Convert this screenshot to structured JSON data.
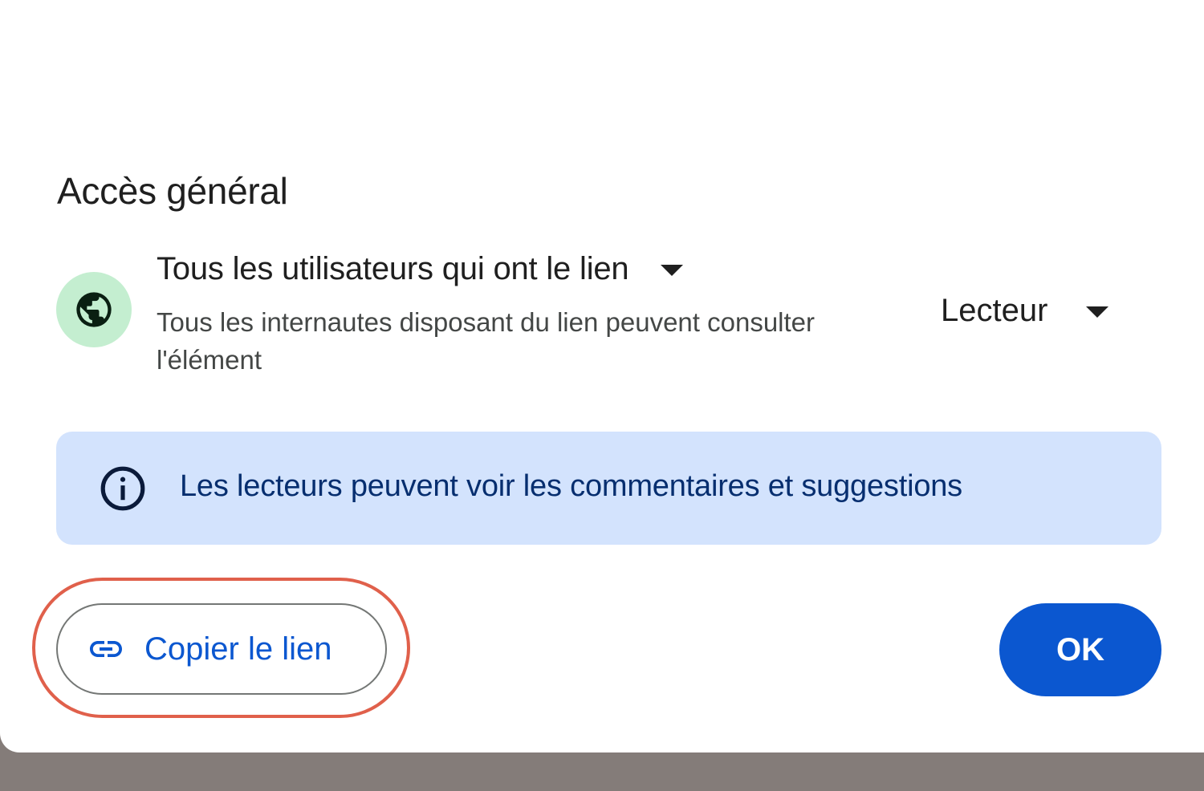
{
  "section": {
    "title": "Accès général"
  },
  "general_access": {
    "icon": "globe-icon",
    "label": "Tous les utilisateurs qui ont le lien",
    "description": "Tous les internautes disposant du lien peuvent consulter l'élément"
  },
  "role": {
    "label": "Lecteur"
  },
  "info_banner": {
    "icon": "info-icon",
    "text": "Les lecteurs peuvent voir les commentaires et suggestions"
  },
  "actions": {
    "copy_link_label": "Copier le lien",
    "copy_link_icon": "link-icon",
    "ok_label": "OK"
  },
  "colors": {
    "primary": "#0b57d0",
    "banner_bg": "#d3e3fd",
    "globe_bg": "#c4eed0",
    "highlight": "#e0604b"
  }
}
